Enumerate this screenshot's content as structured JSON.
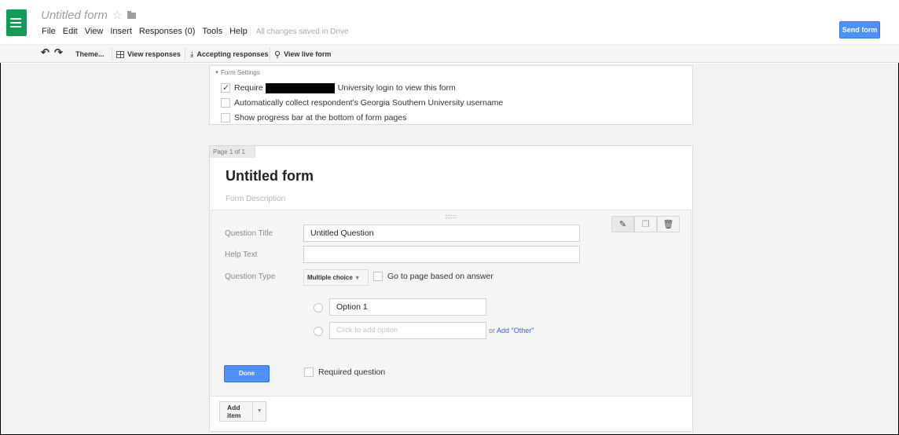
{
  "app": {
    "doc_title": "Untitled form",
    "menu": [
      "File",
      "Edit",
      "View",
      "Insert",
      "Responses (0)",
      "Tools",
      "Help"
    ],
    "save_status": "All changes saved in Drive",
    "send_label": "Send form",
    "accent": "#4d90fe",
    "logo_color": "#0f9d58"
  },
  "toolbar": {
    "undo_icon": "undo-icon",
    "redo_icon": "redo-icon",
    "theme_label": "Theme...",
    "view_responses_label": "View responses",
    "accepting_label": "Accepting responses",
    "live_form_label": "View live form"
  },
  "settings": {
    "header": "Form Settings",
    "require_prefix": "Require",
    "require_suffix": "University login to view this form",
    "collect_label": "Automatically collect respondent's Georgia Southern University username",
    "progress_label": "Show progress bar at the bottom of form pages"
  },
  "form": {
    "page_label": "Page 1 of 1",
    "title": "Untitled form",
    "description_placeholder": "Form Description"
  },
  "question": {
    "title_label": "Question Title",
    "title_value": "Untitled Question",
    "help_label": "Help Text",
    "help_value": "",
    "type_label": "Question Type",
    "type_value": "Multiple choice",
    "goto_label": "Go to page based on answer",
    "option1": "Option 1",
    "add_option_placeholder": "Click to add option",
    "or_label": "or",
    "add_other": "Add \"Other\"",
    "done_label": "Done",
    "required_label": "Required question"
  },
  "add_item_label": "Add item"
}
